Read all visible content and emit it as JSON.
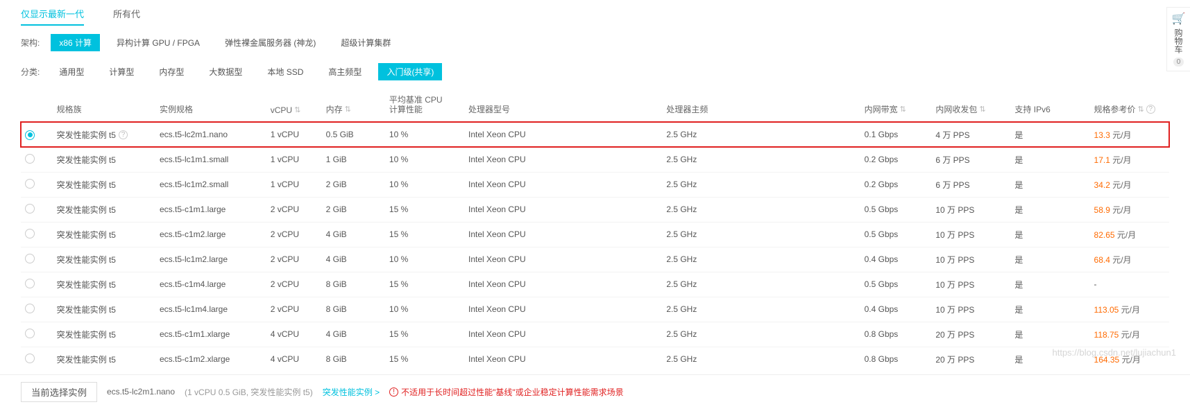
{
  "top_tabs": {
    "latest_gen": "仅显示最新一代",
    "all_gen": "所有代"
  },
  "arch": {
    "label": "架构:",
    "x86": "x86 计算",
    "gpu": "异构计算 GPU / FPGA",
    "bare": "弹性裸金属服务器 (神龙)",
    "super": "超级计算集群"
  },
  "cat": {
    "label": "分类:",
    "general": "通用型",
    "compute": "计算型",
    "memory": "内存型",
    "bigdata": "大数据型",
    "ssd": "本地 SSD",
    "clock": "高主频型",
    "entry": "入门级(共享)"
  },
  "headers": {
    "family": "规格族",
    "spec": "实例规格",
    "vcpu": "vCPU",
    "mem": "内存",
    "base": "平均基准 CPU\n计算性能",
    "cputype": "处理器型号",
    "cpuhz": "处理器主频",
    "innet": "内网带宽",
    "pps": "内网收发包",
    "ipv6": "支持 IPv6",
    "price": "规格参考价"
  },
  "family_name": "突发性能实例 t5",
  "price_unit": " 元/月",
  "yes": "是",
  "dash": "-",
  "rows": [
    {
      "spec": "ecs.t5-lc2m1.nano",
      "vcpu": "1 vCPU",
      "mem": "0.5 GiB",
      "base": "10 %",
      "cpu": "Intel Xeon CPU",
      "hz": "2.5 GHz",
      "bw": "0.1 Gbps",
      "pps": "4 万 PPS",
      "ipv6": "是",
      "price": "13.3",
      "sel": true,
      "hl": true,
      "help": true
    },
    {
      "spec": "ecs.t5-lc1m1.small",
      "vcpu": "1 vCPU",
      "mem": "1 GiB",
      "base": "10 %",
      "cpu": "Intel Xeon CPU",
      "hz": "2.5 GHz",
      "bw": "0.2 Gbps",
      "pps": "6 万 PPS",
      "ipv6": "是",
      "price": "17.1"
    },
    {
      "spec": "ecs.t5-lc1m2.small",
      "vcpu": "1 vCPU",
      "mem": "2 GiB",
      "base": "10 %",
      "cpu": "Intel Xeon CPU",
      "hz": "2.5 GHz",
      "bw": "0.2 Gbps",
      "pps": "6 万 PPS",
      "ipv6": "是",
      "price": "34.2"
    },
    {
      "spec": "ecs.t5-c1m1.large",
      "vcpu": "2 vCPU",
      "mem": "2 GiB",
      "base": "15 %",
      "cpu": "Intel Xeon CPU",
      "hz": "2.5 GHz",
      "bw": "0.5 Gbps",
      "pps": "10 万 PPS",
      "ipv6": "是",
      "price": "58.9"
    },
    {
      "spec": "ecs.t5-c1m2.large",
      "vcpu": "2 vCPU",
      "mem": "4 GiB",
      "base": "15 %",
      "cpu": "Intel Xeon CPU",
      "hz": "2.5 GHz",
      "bw": "0.5 Gbps",
      "pps": "10 万 PPS",
      "ipv6": "是",
      "price": "82.65"
    },
    {
      "spec": "ecs.t5-lc1m2.large",
      "vcpu": "2 vCPU",
      "mem": "4 GiB",
      "base": "10 %",
      "cpu": "Intel Xeon CPU",
      "hz": "2.5 GHz",
      "bw": "0.4 Gbps",
      "pps": "10 万 PPS",
      "ipv6": "是",
      "price": "68.4"
    },
    {
      "spec": "ecs.t5-c1m4.large",
      "vcpu": "2 vCPU",
      "mem": "8 GiB",
      "base": "15 %",
      "cpu": "Intel Xeon CPU",
      "hz": "2.5 GHz",
      "bw": "0.5 Gbps",
      "pps": "10 万 PPS",
      "ipv6": "是",
      "price": "-"
    },
    {
      "spec": "ecs.t5-lc1m4.large",
      "vcpu": "2 vCPU",
      "mem": "8 GiB",
      "base": "10 %",
      "cpu": "Intel Xeon CPU",
      "hz": "2.5 GHz",
      "bw": "0.4 Gbps",
      "pps": "10 万 PPS",
      "ipv6": "是",
      "price": "113.05"
    },
    {
      "spec": "ecs.t5-c1m1.xlarge",
      "vcpu": "4 vCPU",
      "mem": "4 GiB",
      "base": "15 %",
      "cpu": "Intel Xeon CPU",
      "hz": "2.5 GHz",
      "bw": "0.8 Gbps",
      "pps": "20 万 PPS",
      "ipv6": "是",
      "price": "118.75"
    },
    {
      "spec": "ecs.t5-c1m2.xlarge",
      "vcpu": "4 vCPU",
      "mem": "8 GiB",
      "base": "15 %",
      "cpu": "Intel Xeon CPU",
      "hz": "2.5 GHz",
      "bw": "0.8 Gbps",
      "pps": "20 万 PPS",
      "ipv6": "是",
      "price": "164.35"
    }
  ],
  "footer": {
    "select_btn": "当前选择实例",
    "spec": "ecs.t5-lc2m1.nano",
    "desc": "(1 vCPU 0.5 GiB, 突发性能实例 t5)",
    "link": "突发性能实例 >",
    "warn": "不适用于长时间超过性能\"基线\"或企业稳定计算性能需求场景"
  },
  "cart": {
    "label": "购物车",
    "count": "0"
  },
  "watermark": "https://blog.csdn.net/lujiachun1"
}
